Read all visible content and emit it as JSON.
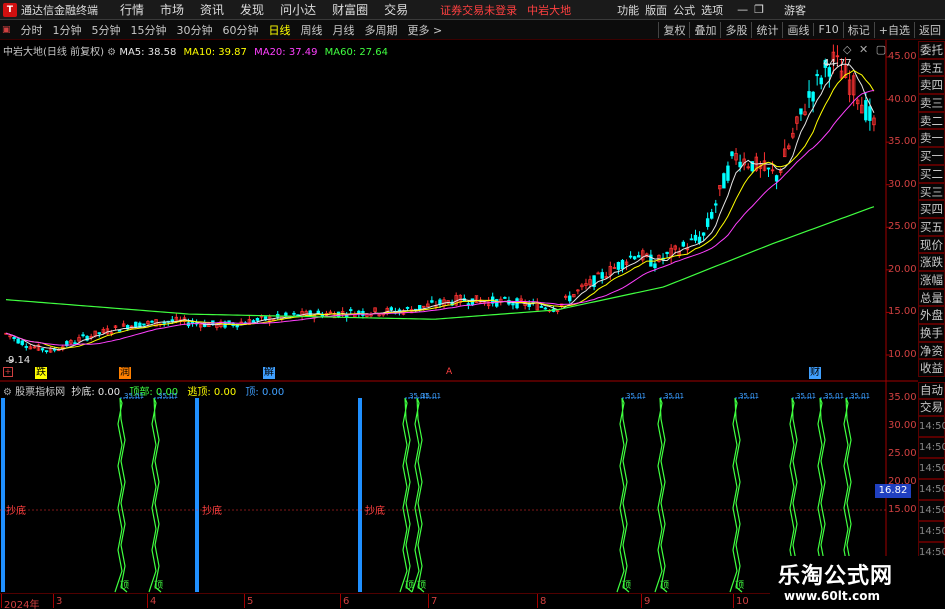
{
  "menubar": {
    "app_name": "通达信金融终端",
    "menus": [
      "行情",
      "市场",
      "资讯",
      "发现",
      "问小达",
      "财富圈",
      "交易"
    ],
    "notice": "证券交易未登录",
    "stock_name": "中岩大地",
    "right_items": [
      "功能",
      "版面",
      "公式",
      "选项"
    ],
    "guest": "游客"
  },
  "periodbar": {
    "periods": [
      "分时",
      "1分钟",
      "5分钟",
      "15分钟",
      "30分钟",
      "60分钟",
      "日线",
      "周线",
      "月线",
      "多周期",
      "更多 >"
    ],
    "active": "日线",
    "tools": [
      "复权",
      "叠加",
      "多股",
      "统计",
      "画线",
      "F10",
      "标记",
      "+自选",
      "返回"
    ]
  },
  "main_chart": {
    "title": "中岩大地(日线 前复权)",
    "indicators": [
      {
        "label": "MA5: 38.58",
        "color": "#e6e6e6"
      },
      {
        "label": "MA10: 39.87",
        "color": "#ffff00"
      },
      {
        "label": "MA20: 37.49",
        "color": "#ff40ff"
      },
      {
        "label": "MA60: 27.64",
        "color": "#40ff40"
      }
    ],
    "y_ticks": [
      "45.00",
      "40.00",
      "35.00",
      "30.00",
      "25.00",
      "20.00",
      "15.00",
      "10.00"
    ],
    "high_label": "44.77",
    "low_label": "9.14",
    "markers": [
      {
        "text": "跌",
        "color": "#ffff00"
      },
      {
        "text": "润",
        "color": "#ff8000"
      },
      {
        "text": "解",
        "color": "#40a0ff"
      },
      {
        "text": "A",
        "color": "#ff4040"
      },
      {
        "text": "财",
        "color": "#40a0ff"
      }
    ]
  },
  "sub_chart": {
    "title": "股票指标网",
    "items": [
      {
        "label": "抄底: 0.00",
        "color": "#e6e6e6"
      },
      {
        "label": "顶部: 0.00",
        "color": "#40ff40"
      },
      {
        "label": "逃顶: 0.00",
        "color": "#ffff00"
      },
      {
        "label": "顶: 0.00",
        "color": "#40a0ff"
      }
    ],
    "y_ticks": [
      "35.00",
      "30.00",
      "25.00",
      "20.00",
      "15.00"
    ],
    "current_value": "16.82",
    "chaodi_label": "抄底",
    "peak_label": "35.01",
    "bottom_label": "顶"
  },
  "x_axis": {
    "labels": [
      "2024年",
      "3",
      "4",
      "5",
      "6",
      "7",
      "8",
      "9",
      "10"
    ]
  },
  "side_panel": {
    "top_items": [
      "委托",
      "卖五",
      "卖四",
      "卖三",
      "卖二",
      "卖一",
      "买一",
      "买二",
      "买三",
      "买四",
      "买五",
      "现价",
      "涨跌",
      "涨幅",
      "总量",
      "外盘",
      "换手",
      "净资",
      "收益"
    ],
    "bottom_items": [
      "自动",
      "交易"
    ],
    "times": [
      "14:50",
      "14:50",
      "14:50",
      "14:50",
      "14:50",
      "14:50",
      "14:50",
      "14:50"
    ]
  },
  "watermark": {
    "title": "乐淘公式网",
    "url": "www.60lt.com"
  }
}
